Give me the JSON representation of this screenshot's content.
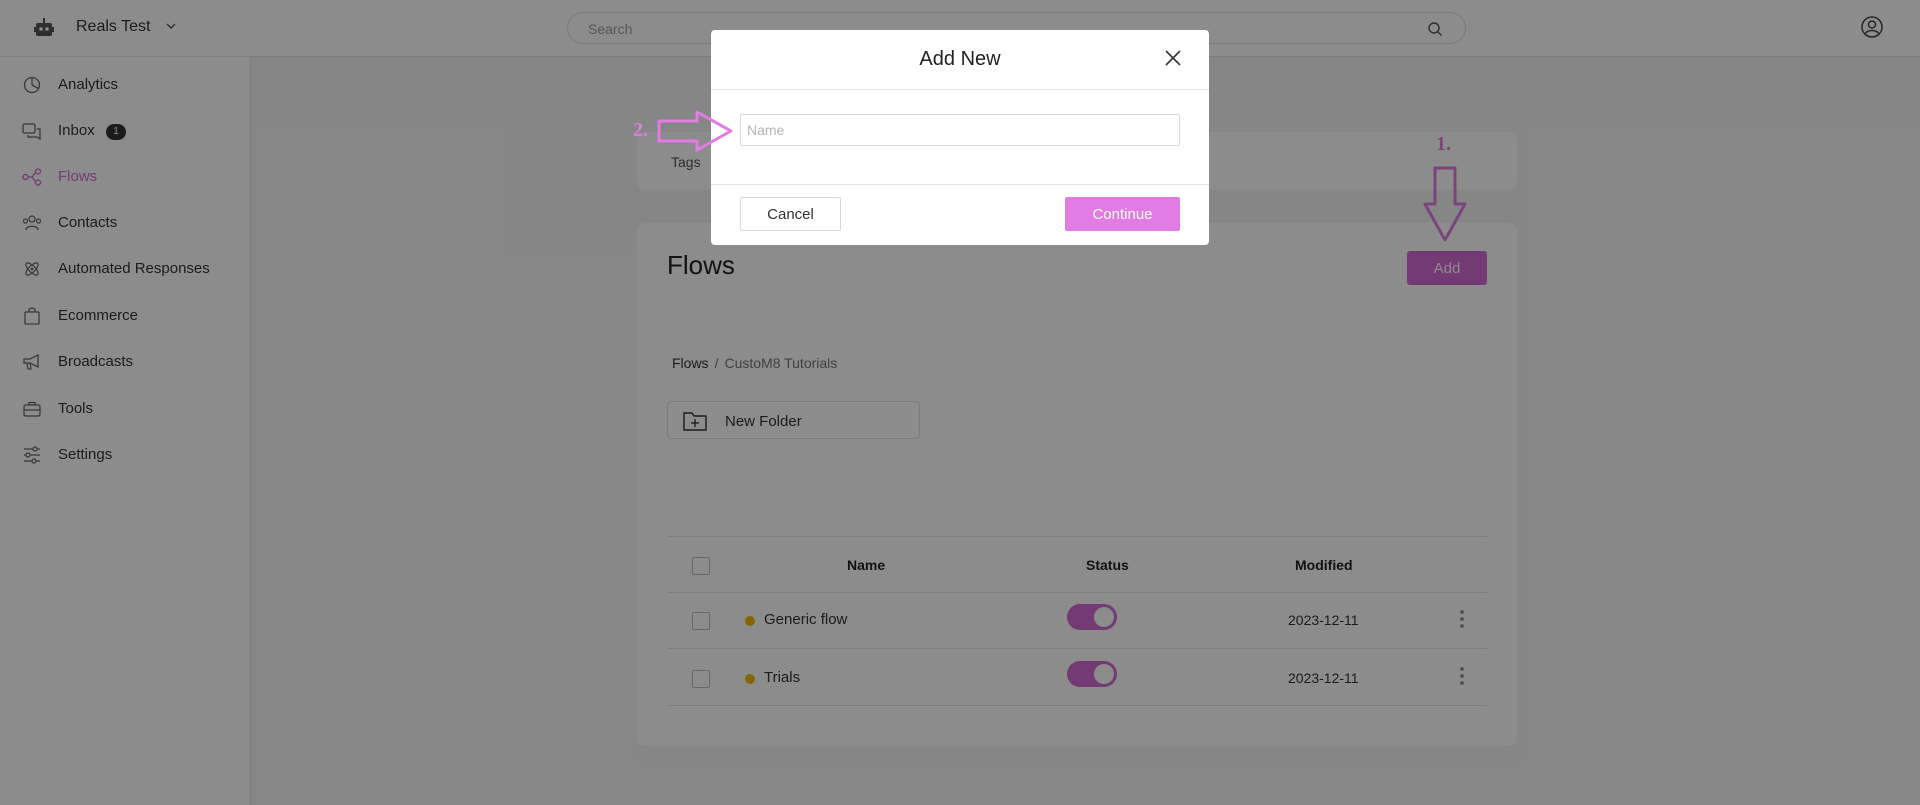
{
  "header": {
    "workspace_name": "Reals Test",
    "search_placeholder": "Search"
  },
  "sidebar": {
    "items": [
      {
        "label": "Analytics",
        "icon": "pie-chart-icon"
      },
      {
        "label": "Inbox",
        "icon": "chat-bubbles-icon",
        "badge": "1"
      },
      {
        "label": "Flows",
        "icon": "flow-nodes-icon",
        "active": true
      },
      {
        "label": "Contacts",
        "icon": "users-icon"
      },
      {
        "label": "Automated Responses",
        "icon": "atom-icon"
      },
      {
        "label": "Ecommerce",
        "icon": "shopping-bag-icon"
      },
      {
        "label": "Broadcasts",
        "icon": "megaphone-icon"
      },
      {
        "label": "Tools",
        "icon": "toolbox-icon"
      },
      {
        "label": "Settings",
        "icon": "sliders-icon"
      }
    ]
  },
  "tags_card": {
    "label": "Tags"
  },
  "flows": {
    "title": "Flows",
    "add_label": "Add",
    "breadcrumb": {
      "root": "Flows",
      "separator": "/",
      "current": "CustoM8 Tutorials"
    },
    "new_folder_label": "New Folder",
    "columns": {
      "name": "Name",
      "status": "Status",
      "modified": "Modified"
    },
    "rows": [
      {
        "name": "Generic flow",
        "enabled": true,
        "modified": "2023-12-11"
      },
      {
        "name": "Trials",
        "enabled": true,
        "modified": "2023-12-11"
      }
    ]
  },
  "modal": {
    "title": "Add New",
    "name_placeholder": "Name",
    "name_value": "",
    "cancel_label": "Cancel",
    "continue_label": "Continue"
  },
  "annotations": {
    "step1": "1.",
    "step2": "2."
  },
  "colors": {
    "accent": "#d26ad2",
    "accent_light": "#e27ce4",
    "status_dot": "#f2b800",
    "overlay": "rgba(0,0,0,0.45)"
  }
}
